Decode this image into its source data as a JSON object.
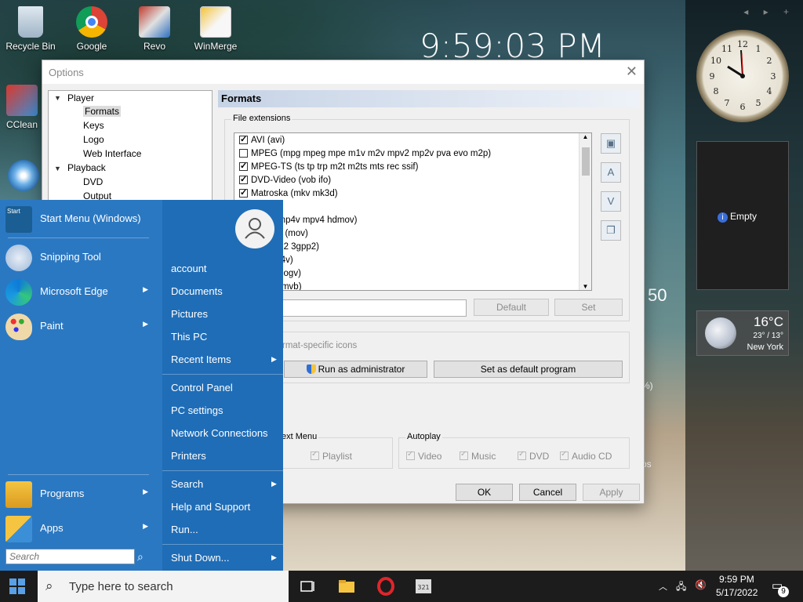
{
  "desktop": {
    "icons": [
      {
        "label": "Recycle Bin"
      },
      {
        "label": "Google"
      },
      {
        "label": "Revo"
      },
      {
        "label": "WinMerge"
      },
      {
        "label": "CClean"
      }
    ],
    "big_clock": "9:59:03 PM"
  },
  "gadgets": {
    "slideshow_label": "Empty",
    "weather": {
      "temp": "16°C",
      "range": "23° / 13°",
      "city": "New York"
    },
    "peek_number": "50"
  },
  "dialog": {
    "title": "Options",
    "tree": {
      "player": "Player",
      "formats": "Formats",
      "keys": "Keys",
      "logo": "Logo",
      "web_interface": "Web Interface",
      "playback": "Playback",
      "dvd": "DVD",
      "output": "Output"
    },
    "pane_title": "Formats",
    "file_ext_group": "File extensions",
    "formats": [
      {
        "label": "AVI (avi)",
        "checked": true
      },
      {
        "label": "MPEG (mpg mpeg mpe m1v m2v mpv2 mp2v pva evo m2p)",
        "checked": false
      },
      {
        "label": "MPEG-TS (ts tp trp m2t m2ts mts rec ssif)",
        "checked": true
      },
      {
        "label": "DVD-Video (vob ifo)",
        "checked": true
      },
      {
        "label": "Matroska (mkv mk3d)",
        "checked": true
      },
      {
        "label": "webm)",
        "checked": true
      },
      {
        "label": "4 m4v mp4v mpv4 hdmov)",
        "checked": true
      },
      {
        "label": "e Movie (mov)",
        "checked": true
      },
      {
        "label": "3gpp 3g2 3gpp2)",
        "checked": true
      },
      {
        "label": "eo (flv f4v)",
        "checked": true
      },
      {
        "label": "ia (ogm ogv)",
        "checked": true
      },
      {
        "label": "lia (rm rmvb)",
        "checked": true
      }
    ],
    "default_btn": "Default",
    "set_btn": "Set",
    "format_icons_label": "rmat-specific icons",
    "run_admin_btn": "Run as administrator",
    "set_default_prog_btn": "Set as default program",
    "context_menu_group": "ext Menu",
    "playlist": "Playlist",
    "autoplay_group": "Autoplay",
    "autoplay": {
      "video": "Video",
      "music": "Music",
      "dvd": "DVD",
      "audio_cd": "Audio CD"
    },
    "ok": "OK",
    "cancel": "Cancel",
    "apply": "Apply",
    "frag_percent": "%)",
    "frag_ps": "ps"
  },
  "start_menu": {
    "pinned": [
      {
        "label": "Start Menu (Windows)",
        "arrow": false
      },
      {
        "label": "Snipping Tool",
        "arrow": false
      },
      {
        "label": "Microsoft Edge",
        "arrow": true
      },
      {
        "label": "Paint",
        "arrow": true
      }
    ],
    "programs": "Programs",
    "apps": "Apps",
    "search_placeholder": "Search",
    "right": {
      "account": "account",
      "documents": "Documents",
      "pictures": "Pictures",
      "this_pc": "This PC",
      "recent_items": "Recent Items",
      "control_panel": "Control Panel",
      "pc_settings": "PC settings",
      "network_connections": "Network Connections",
      "printers": "Printers",
      "search": "Search",
      "help_support": "Help and Support",
      "run": "Run...",
      "shut_down": "Shut Down..."
    }
  },
  "taskbar": {
    "search_placeholder": "Type here to search",
    "time": "9:59 PM",
    "date": "5/17/2022",
    "notification_count": "9"
  }
}
